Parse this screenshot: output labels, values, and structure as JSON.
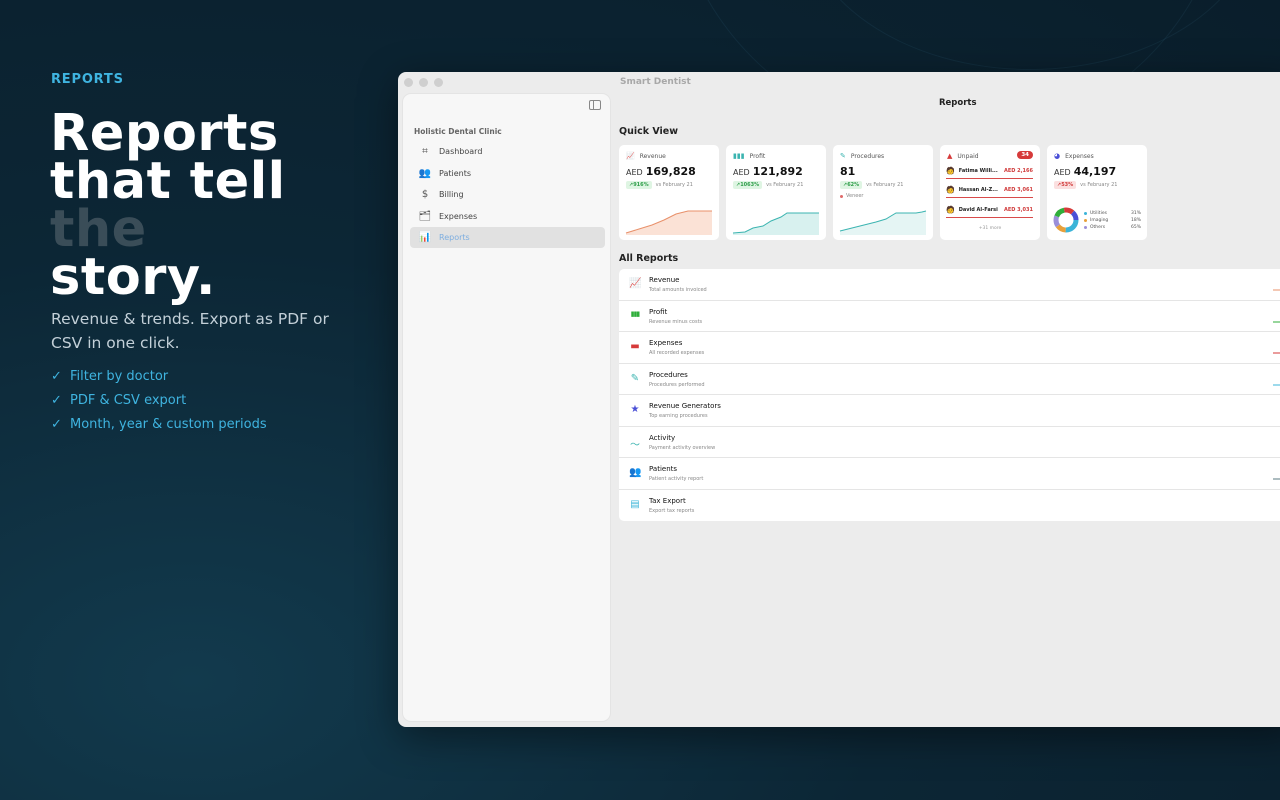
{
  "hero": {
    "eyebrow": "REPORTS",
    "headline_lines": [
      "Reports",
      "that tell",
      "the",
      "story."
    ],
    "subtext": "Revenue & trends. Export as PDF or CSV in one click.",
    "check_glyph": "✓",
    "features": [
      "Filter by doctor",
      "PDF & CSV export",
      "Month, year & custom periods"
    ]
  },
  "window": {
    "title": "Smart Dentist"
  },
  "sidebar": {
    "clinic": "Holistic Dental Clinic",
    "items": [
      {
        "label": "Dashboard",
        "icon": "dashboard-icon",
        "glyph": "⌗"
      },
      {
        "label": "Patients",
        "icon": "patients-icon",
        "glyph": "👥"
      },
      {
        "label": "Billing",
        "icon": "billing-icon",
        "glyph": "$"
      },
      {
        "label": "Expenses",
        "icon": "expenses-icon",
        "glyph": "🗂"
      },
      {
        "label": "Reports",
        "icon": "reports-icon",
        "glyph": "📊",
        "active": true
      }
    ]
  },
  "main": {
    "title": "Reports",
    "quick_view_title": "Quick View",
    "all_reports_title": "All Reports"
  },
  "quick_view": {
    "revenue": {
      "label": "Revenue",
      "currency": "AED",
      "value": "169,828",
      "change": "↗916%",
      "compare": "vs February 21",
      "color": "#e8906a"
    },
    "profit": {
      "label": "Profit",
      "currency": "AED",
      "value": "121,892",
      "change": "↗1063%",
      "compare": "vs February 21",
      "color": "#3bb4b0"
    },
    "procedures": {
      "label": "Procedures",
      "value": "81",
      "change": "↗62%",
      "compare": "vs February 21",
      "sub": "Veneer",
      "color": "#3bb4b0"
    },
    "unpaid": {
      "label": "Unpaid",
      "count": "34",
      "rows": [
        {
          "name": "Fatima Willi...",
          "amount": "AED 2,166"
        },
        {
          "name": "Hassan Al-Z...",
          "amount": "AED 3,061"
        },
        {
          "name": "David Al-Farsi",
          "amount": "AED 3,031"
        }
      ],
      "more": "+31 more"
    },
    "expenses": {
      "label": "Expenses",
      "currency": "AED",
      "value": "44,197",
      "change": "↗53%",
      "compare": "vs February 21",
      "legend": [
        {
          "name": "Utilities",
          "pct": "31%",
          "color": "#3bb4d8"
        },
        {
          "name": "Imaging",
          "pct": "18%",
          "color": "#e8a03a"
        },
        {
          "name": "Others",
          "pct": "65%",
          "color": "#9b8fd8"
        }
      ]
    }
  },
  "reports": [
    {
      "title": "Revenue",
      "sub": "Total amounts invoiced",
      "icon": "revenue-trend-icon",
      "glyph": "📈",
      "color": "#e8906a"
    },
    {
      "title": "Profit",
      "sub": "Revenue minus costs",
      "icon": "profit-bars-icon",
      "glyph": "▮▮▮",
      "color": "#2fae3a"
    },
    {
      "title": "Expenses",
      "sub": "All recorded expenses",
      "icon": "expenses-card-icon",
      "glyph": "▬",
      "color": "#d63a3a"
    },
    {
      "title": "Procedures",
      "sub": "Procedures performed",
      "icon": "procedures-pen-icon",
      "glyph": "✎",
      "color": "#3bb4b0"
    },
    {
      "title": "Revenue Generators",
      "sub": "Top earning procedures",
      "icon": "star-icon",
      "glyph": "★",
      "color": "#4a4fd6"
    },
    {
      "title": "Activity",
      "sub": "Payment activity overview",
      "icon": "activity-pulse-icon",
      "glyph": "〜",
      "color": "#3bb4b0"
    },
    {
      "title": "Patients",
      "sub": "Patient activity report",
      "icon": "patients-group-icon",
      "glyph": "👥",
      "color": "#2f8a5a"
    },
    {
      "title": "Tax Export",
      "sub": "Export tax reports",
      "icon": "document-icon",
      "glyph": "▤",
      "color": "#3bb4d8"
    }
  ]
}
